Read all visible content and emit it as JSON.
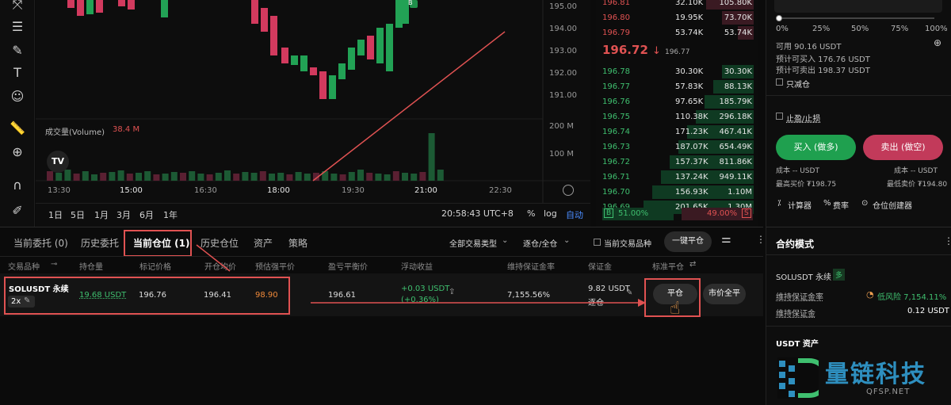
{
  "toolbar": {
    "icons": [
      "pointer-icon",
      "settings-sliders-icon",
      "brush-icon",
      "text-icon",
      "emoji-icon",
      "ruler-icon",
      "zoom-icon",
      "magnet-icon",
      "pencil-lock-icon"
    ]
  },
  "chart": {
    "price_ticks": [
      "195.00",
      "194.00",
      "193.00",
      "192.00",
      "191.00"
    ],
    "volume_label": "成交量(Volume)",
    "volume_value": "38.4 M",
    "vol_ticks": [
      "200 M",
      "100 M"
    ],
    "time_ticks": [
      "13:30",
      "15:00",
      "16:30",
      "18:00",
      "19:30",
      "21:00",
      "22:30"
    ],
    "timeframes": [
      "1日",
      "5日",
      "1月",
      "3月",
      "6月",
      "1年"
    ],
    "clock": "20:58:43 UTC+8",
    "pct": "%",
    "log": "log",
    "auto": "自动",
    "marker": "B"
  },
  "orderbook": {
    "asks": [
      [
        "196.81",
        "32.10K",
        "105.80K"
      ],
      [
        "196.80",
        "19.95K",
        "73.70K"
      ],
      [
        "196.79",
        "53.74K",
        "53.74K"
      ]
    ],
    "last_price": "196.72",
    "arrow": "↓",
    "mark": "196.77",
    "bids": [
      [
        "196.78",
        "30.30K",
        "30.30K"
      ],
      [
        "196.77",
        "57.83K",
        "88.13K"
      ],
      [
        "196.76",
        "97.65K",
        "185.79K"
      ],
      [
        "196.75",
        "110.38K",
        "296.18K"
      ],
      [
        "196.74",
        "171.23K",
        "467.41K"
      ],
      [
        "196.73",
        "187.07K",
        "654.49K"
      ],
      [
        "196.72",
        "157.37K",
        "811.86K"
      ],
      [
        "196.71",
        "137.24K",
        "949.11K"
      ],
      [
        "196.70",
        "156.93K",
        "1.10M"
      ],
      [
        "196.69",
        "201.65K",
        "1.30M"
      ]
    ],
    "buy_tag": "B",
    "buy_pct": "51.00%",
    "sell_pct": "49.00%",
    "sell_tag": "S"
  },
  "right_panel": {
    "slider_labels": [
      "0%",
      "25%",
      "50%",
      "75%",
      "100%"
    ],
    "available": "可用 90.16 USDT",
    "can_buy": "预计可买入 176.76 USDT",
    "can_sell": "预计可卖出 198.37 USDT",
    "reduce_only": "只减仓",
    "tp_sl": "止盈/止损",
    "buy_btn": "买入 (做多)",
    "sell_btn": "卖出 (做空)",
    "cost_l": "成本 -- USDT",
    "cost_r": "成本 -- USDT",
    "max_buy": "最高买价 ₮198.75",
    "min_sell": "最低卖价 ₮194.80",
    "tools": [
      "计算器",
      "费率",
      "仓位创建器"
    ]
  },
  "positions": {
    "tabs": [
      "当前委托 (0)",
      "历史委托",
      "当前仓位 (1)",
      "历史仓位",
      "资产",
      "策略"
    ],
    "filter_type": "全部交易类型",
    "filter_margin": "逐仓/全仓",
    "only_current": "当前交易品种",
    "close_all": "一键平仓",
    "headers": [
      "交易品种",
      "持仓量",
      "标记价格",
      "开仓均价",
      "预估强平价",
      "盈亏平衡价",
      "浮动收益",
      "维持保证金率",
      "保证金",
      "标准平仓"
    ],
    "row": {
      "symbol": "SOLUSDT 永续",
      "leverage": "2x",
      "size": "19.68 USDT",
      "mark": "196.76",
      "entry": "196.41",
      "liq": "98.90",
      "breakeven": "196.61",
      "pnl": "+0.03 USDT",
      "pnl_pct": "(+0.36%)",
      "mmr": "7,155.56%",
      "margin": "9.82 USDT",
      "margin_mode": "逐仓",
      "close": "平仓",
      "market_close": "市价全平"
    }
  },
  "contract": {
    "title": "合约模式",
    "symbol": "SOLUSDT 永续",
    "badge": "多",
    "mmr_label": "维持保证金率",
    "mmr_value": "低风险 7,154.11%",
    "mm_label": "维持保证金",
    "mm_value": "0.12 USDT",
    "assets": "USDT 资产",
    "watermark_name": "量链科技",
    "watermark_url": "QFSP.NET"
  }
}
